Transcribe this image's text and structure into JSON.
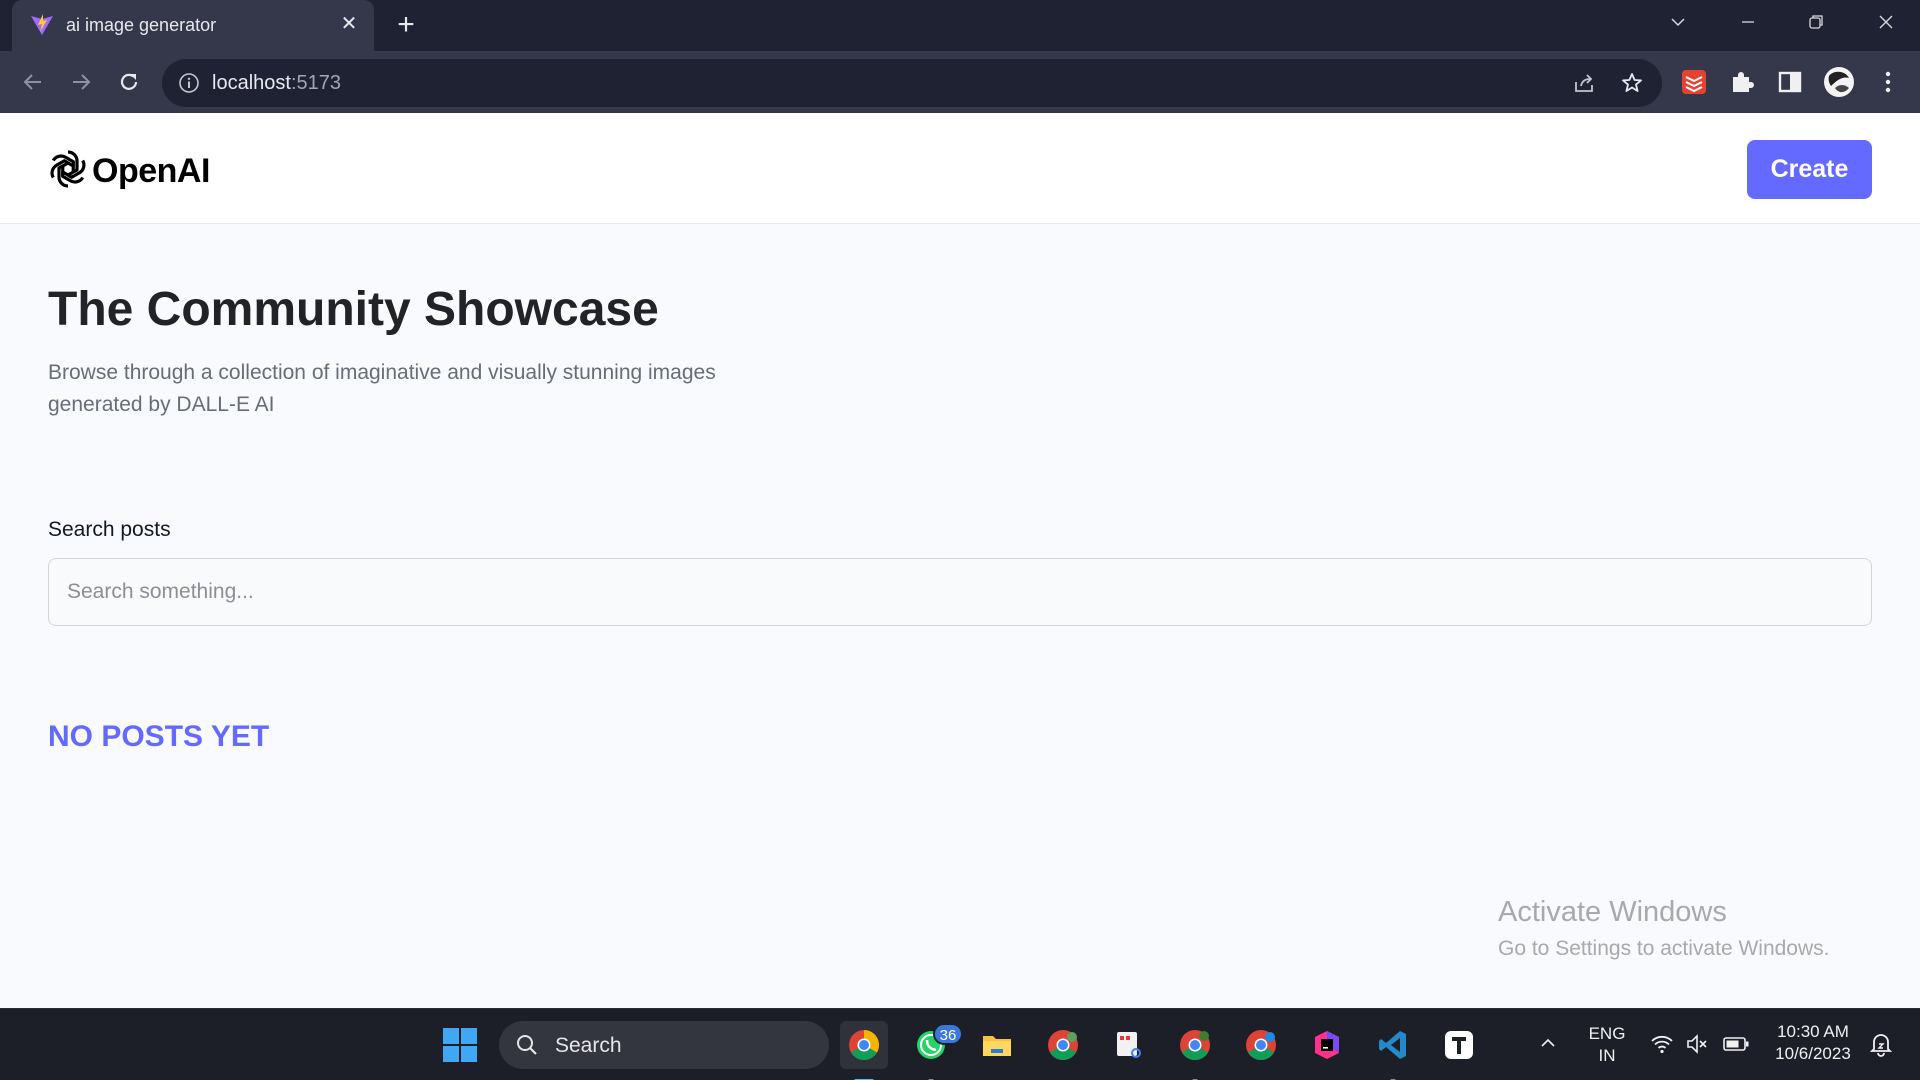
{
  "browser": {
    "tab_title": "ai image generator",
    "tab_close": "✕",
    "new_tab": "+",
    "url_host": "localhost",
    "url_port": ":5173"
  },
  "app": {
    "logo_text": "OpenAI",
    "create_label": "Create",
    "accent_color": "#6469ff"
  },
  "main": {
    "title": "The Community Showcase",
    "subtitle": "Browse through a collection of imaginative and visually stunning images generated by DALL-E AI",
    "search_label": "Search posts",
    "search_placeholder": "Search something...",
    "search_value": "",
    "empty_message": "NO POSTS YET"
  },
  "watermark": {
    "title": "Activate Windows",
    "subtitle": "Go to Settings to activate Windows."
  },
  "taskbar": {
    "search_text": "Search",
    "whatsapp_badge": "36",
    "lang_line1": "ENG",
    "lang_line2": "IN",
    "time": "10:30 AM",
    "date": "10/6/2023",
    "apps": [
      "chrome-icon",
      "whatsapp-icon",
      "file-explorer-icon",
      "chrome-profile-a-icon",
      "snipping-tool-icon",
      "chrome-profile-b-icon",
      "chrome-profile-s-icon",
      "jetbrains-icon",
      "vscode-icon",
      "typora-icon"
    ]
  }
}
